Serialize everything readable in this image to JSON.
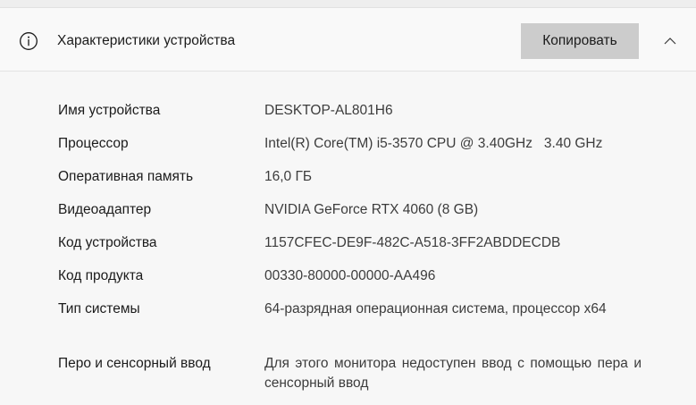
{
  "section": {
    "title": "Характеристики устройства",
    "copy_label": "Копировать",
    "info_icon": "info-circle-icon",
    "collapse_icon": "chevron-up-icon"
  },
  "specs": [
    {
      "label": "Имя устройства",
      "value": "DESKTOP-AL801H6"
    },
    {
      "label": "Процессор",
      "value": "Intel(R) Core(TM) i5-3570 CPU @ 3.40GHz   3.40 GHz"
    },
    {
      "label": "Оперативная память",
      "value": "16,0 ГБ"
    },
    {
      "label": "Видеоадаптер",
      "value": "NVIDIA GeForce RTX 4060 (8 GB)"
    },
    {
      "label": "Код устройства",
      "value": "1157CFEC-DE9F-482C-A518-3FF2ABDDECDB"
    },
    {
      "label": "Код продукта",
      "value": "00330-80000-00000-AA496"
    },
    {
      "label": "Тип системы",
      "value": "64-разрядная операционная система, процессор x64"
    },
    {
      "label": "Перо и сенсорный ввод",
      "value": "Для этого монитора недоступен ввод с помощью пера и сенсорный ввод"
    }
  ],
  "colors": {
    "background": "#f3f3f3",
    "panel": "#f7f7f7",
    "button": "#cccccc",
    "text": "#1b1b1b",
    "value_text": "#3c3c3c"
  }
}
